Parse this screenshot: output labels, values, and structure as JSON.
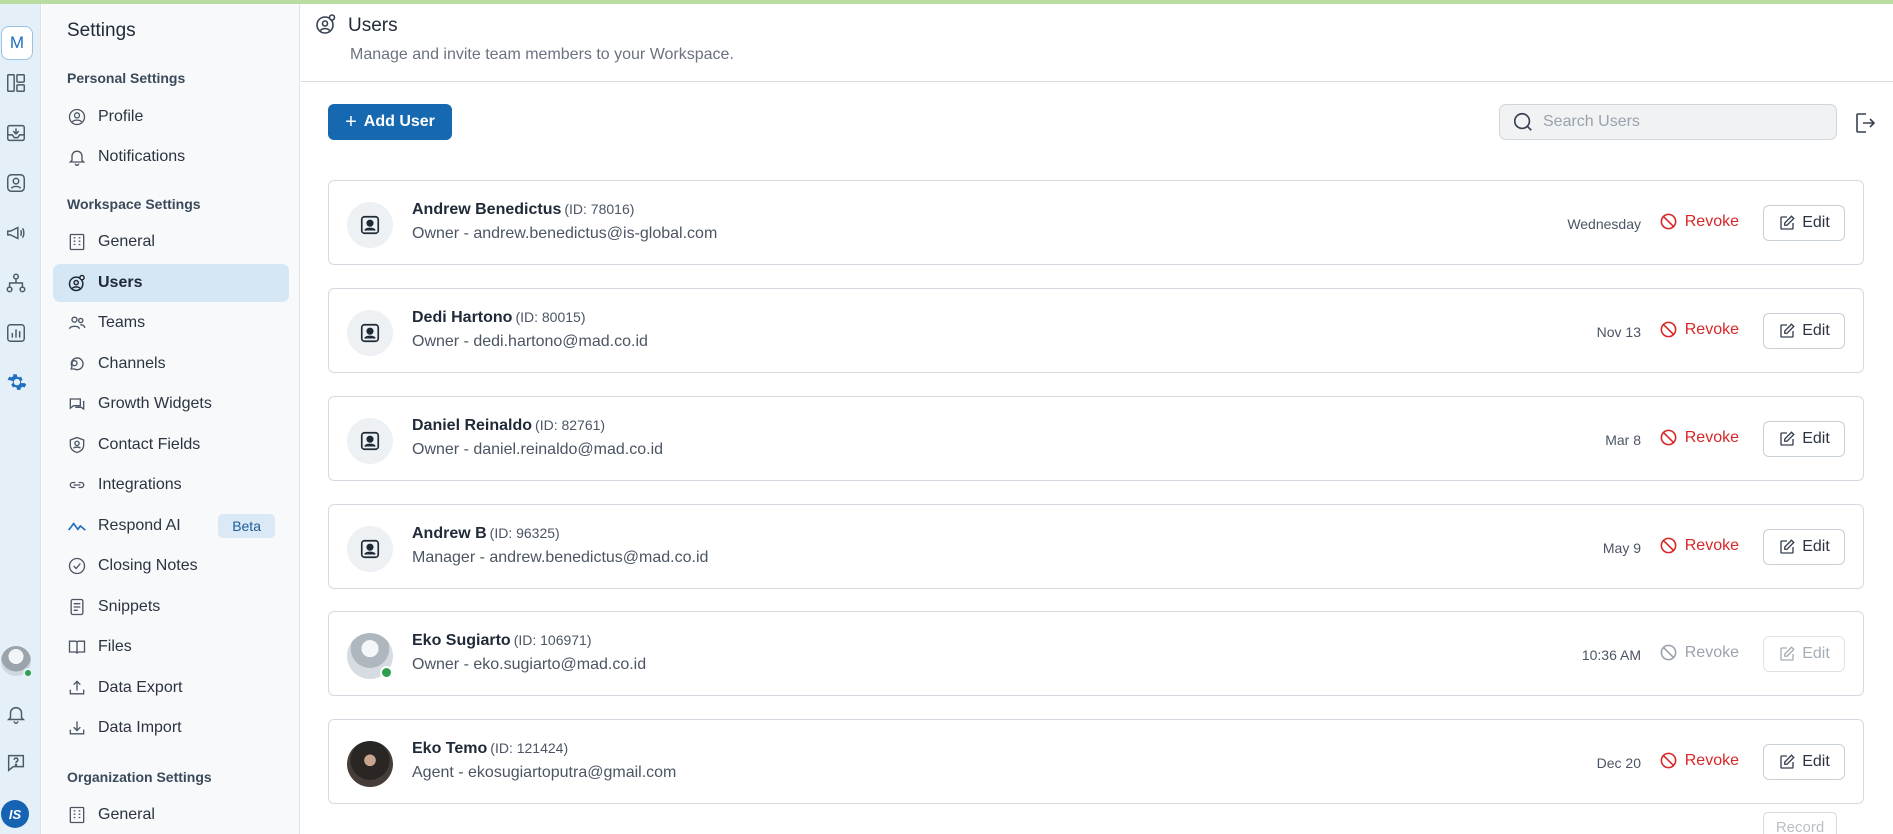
{
  "rail": {
    "workspace_initial": "M",
    "brand_initials": "IS",
    "icons": [
      "layout-icon",
      "inbox-icon",
      "contacts-icon",
      "broadcast-icon",
      "flows-icon",
      "reports-icon",
      "settings-icon"
    ],
    "bottom_icons": [
      "bell-icon",
      "help-icon"
    ],
    "active_color": "#1f6fbf"
  },
  "sidebar": {
    "title": "Settings",
    "personal_label": "Personal Settings",
    "personal_items": [
      {
        "label": "Profile",
        "icon": "profile-icon"
      },
      {
        "label": "Notifications",
        "icon": "bell-icon"
      }
    ],
    "workspace_label": "Workspace Settings",
    "workspace_items": [
      {
        "label": "General",
        "icon": "building-icon"
      },
      {
        "label": "Users",
        "icon": "users-icon",
        "active": true
      },
      {
        "label": "Teams",
        "icon": "teams-icon"
      },
      {
        "label": "Channels",
        "icon": "channels-icon"
      },
      {
        "label": "Growth Widgets",
        "icon": "chat-widget-icon"
      },
      {
        "label": "Contact Fields",
        "icon": "contact-fields-icon"
      },
      {
        "label": "Integrations",
        "icon": "link-icon"
      },
      {
        "label": "Respond AI",
        "icon": "respond-ai-icon",
        "badge": "Beta"
      },
      {
        "label": "Closing Notes",
        "icon": "check-circle-icon"
      },
      {
        "label": "Snippets",
        "icon": "snippets-icon"
      },
      {
        "label": "Files",
        "icon": "book-icon"
      },
      {
        "label": "Data Export",
        "icon": "export-icon"
      },
      {
        "label": "Data Import",
        "icon": "import-icon"
      }
    ],
    "org_label": "Organization Settings",
    "org_items": [
      {
        "label": "General",
        "icon": "building-icon"
      }
    ]
  },
  "header": {
    "title": "Users",
    "subtitle": "Manage and invite team members to your Workspace."
  },
  "toolbar": {
    "add_label": "Add User",
    "search_placeholder": "Search Users"
  },
  "users": [
    {
      "name": "Andrew Benedictus",
      "id": "(ID: 78016)",
      "role_email": "Owner - andrew.benedictus@is-global.com",
      "date": "Wednesday",
      "revoke": "Revoke",
      "edit": "Edit",
      "avatar": "default",
      "enabled": true
    },
    {
      "name": "Dedi Hartono",
      "id": "(ID: 80015)",
      "role_email": "Owner - dedi.hartono@mad.co.id",
      "date": "Nov 13",
      "revoke": "Revoke",
      "edit": "Edit",
      "avatar": "default",
      "enabled": true
    },
    {
      "name": "Daniel Reinaldo",
      "id": "(ID: 82761)",
      "role_email": "Owner - daniel.reinaldo@mad.co.id",
      "date": "Mar 8",
      "revoke": "Revoke",
      "edit": "Edit",
      "avatar": "default",
      "enabled": true
    },
    {
      "name": "Andrew B",
      "id": "(ID: 96325)",
      "role_email": "Manager - andrew.benedictus@mad.co.id",
      "date": "May 9",
      "revoke": "Revoke",
      "edit": "Edit",
      "avatar": "default",
      "enabled": true
    },
    {
      "name": "Eko Sugiarto",
      "id": "(ID: 106971)",
      "role_email": "Owner - eko.sugiarto@mad.co.id",
      "date": "10:36 AM",
      "revoke": "Revoke",
      "edit": "Edit",
      "avatar": "robot",
      "enabled": false
    },
    {
      "name": "Eko Temo",
      "id": "(ID: 121424)",
      "role_email": "Agent - ekosugiartoputra@gmail.com",
      "date": "Dec 20",
      "revoke": "Revoke",
      "edit": "Edit",
      "avatar": "woman",
      "enabled": true
    }
  ],
  "footer": {
    "record_label": "Record"
  },
  "colors": {
    "primary": "#1668b0",
    "danger": "#d92626",
    "active_bg": "#d5e6f4",
    "online": "#2e9e4f"
  }
}
